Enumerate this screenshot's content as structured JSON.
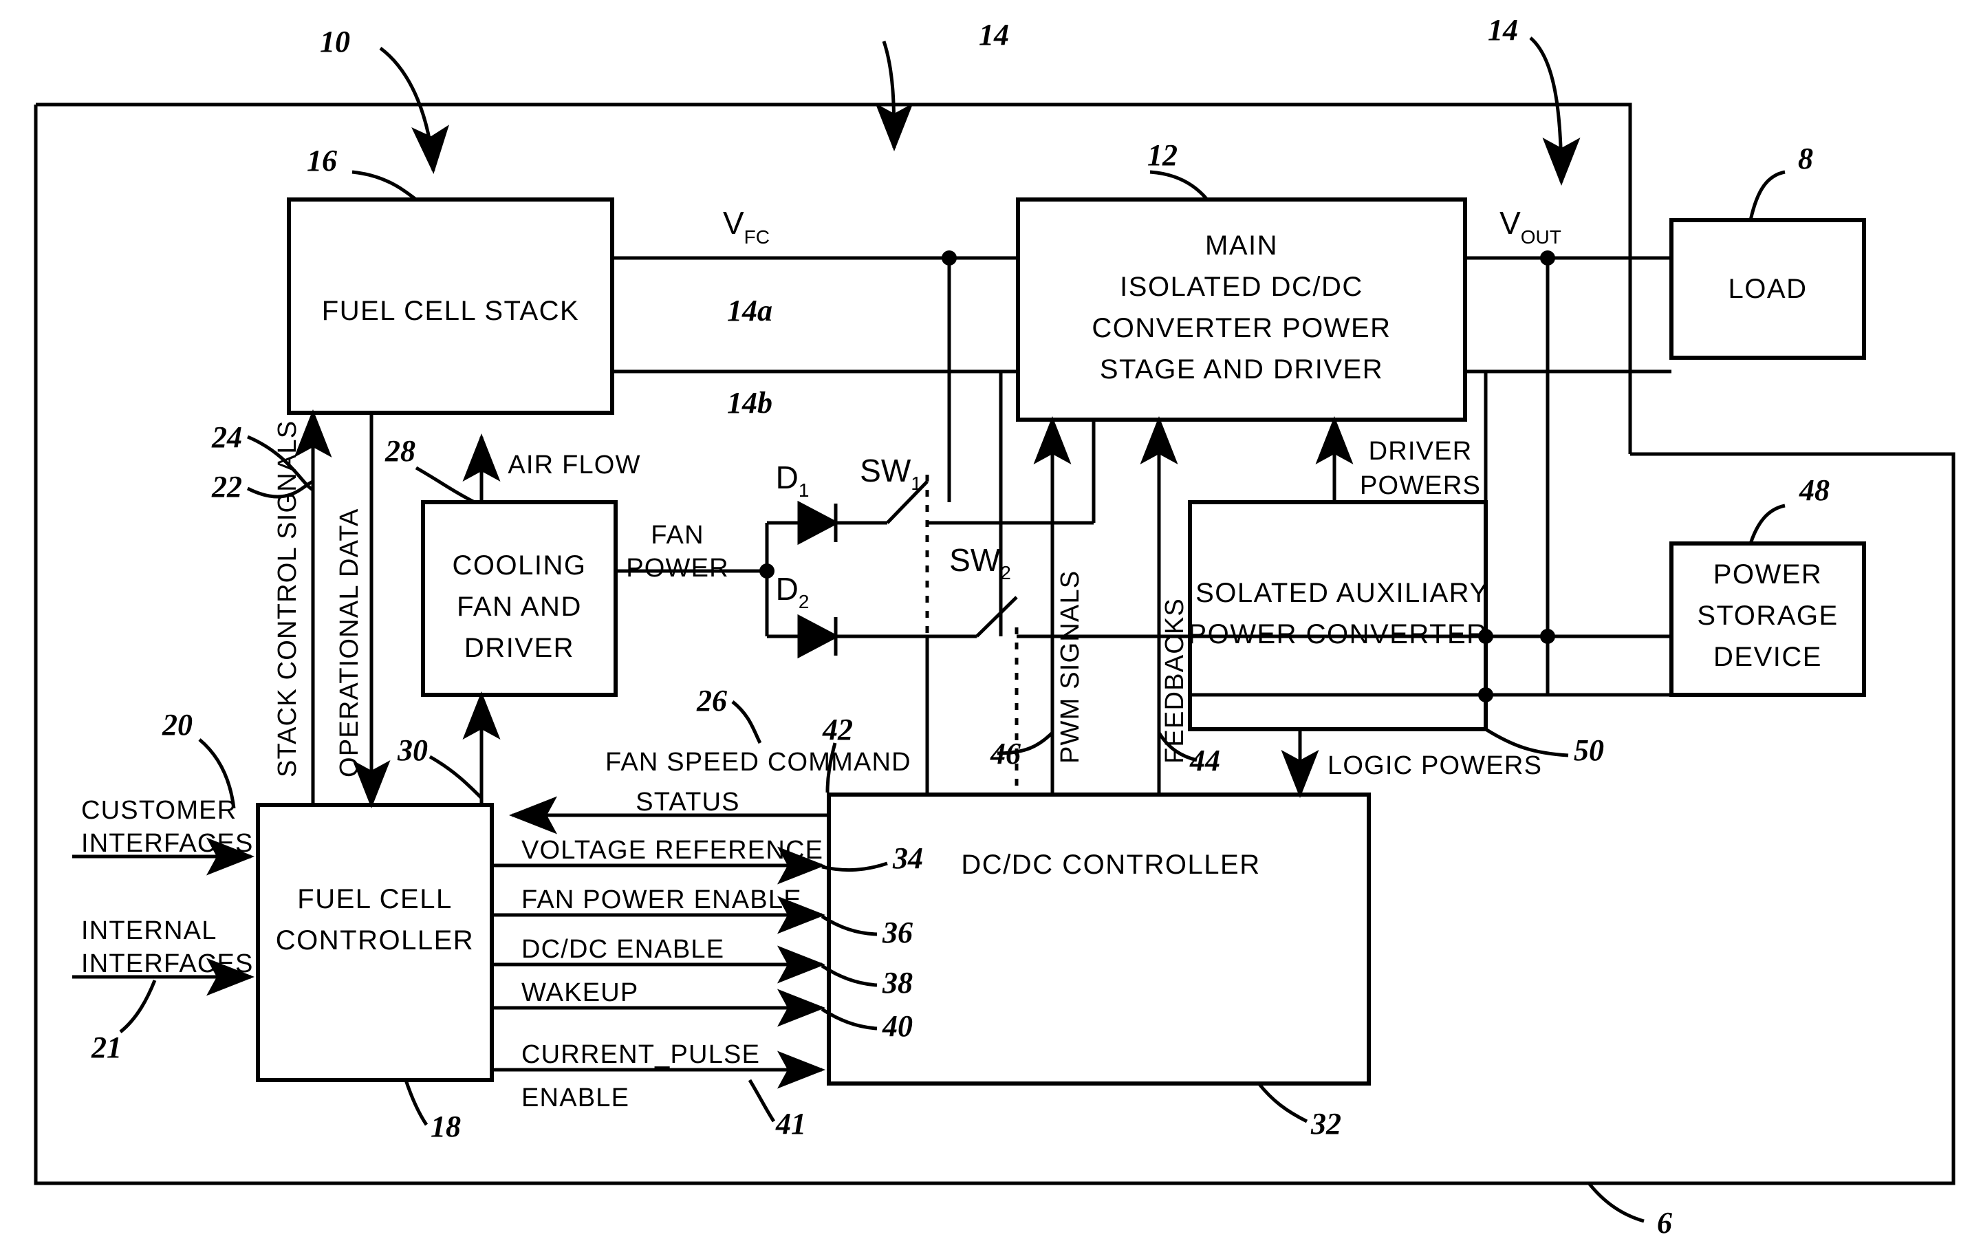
{
  "figure": {
    "outer_ref": "6",
    "system_ref": "10",
    "bus_ref_top_left": "14",
    "bus_ref_top_right": "14"
  },
  "blocks": {
    "fuel_cell_stack": {
      "ref": "16",
      "lines": [
        "FUEL CELL STACK"
      ]
    },
    "main_converter": {
      "ref": "12",
      "lines": [
        "MAIN",
        "ISOLATED DC/DC",
        "CONVERTER POWER",
        "STAGE AND DRIVER"
      ]
    },
    "load": {
      "ref": "8",
      "lines": [
        "LOAD"
      ]
    },
    "power_storage": {
      "ref": "48",
      "lines": [
        "POWER",
        "STORAGE",
        "DEVICE"
      ]
    },
    "aux_converter": {
      "ref": "50",
      "lines": [
        "ISOLATED AUXILIARY",
        "POWER CONVERTER"
      ]
    },
    "cooling_fan": {
      "ref": "26",
      "lines": [
        "COOLING",
        "FAN AND",
        "DRIVER"
      ]
    },
    "fuel_cell_controller": {
      "ref": "18",
      "lines": [
        "FUEL CELL",
        "CONTROLLER"
      ]
    },
    "dcdc_controller": {
      "ref": "32",
      "lines": [
        "DC/DC CONTROLLER"
      ]
    }
  },
  "nets": {
    "vfc": {
      "label": "V",
      "sub": "FC"
    },
    "vout": {
      "label": "V",
      "sub": "OUT"
    },
    "bus_a": "14a",
    "bus_b": "14b"
  },
  "components": {
    "d1": {
      "label": "D",
      "sub": "1"
    },
    "d2": {
      "label": "D",
      "sub": "2"
    },
    "sw1": {
      "label": "SW",
      "sub": "1"
    },
    "sw2": {
      "label": "SW",
      "sub": "2"
    }
  },
  "signals": {
    "stack_control_signals": {
      "text": "STACK CONTROL SIGNALS",
      "ref": "22"
    },
    "operational_data": {
      "text": "OPERATIONAL DATA",
      "ref": "24"
    },
    "air_flow": {
      "text": "AIR FLOW",
      "ref": "28"
    },
    "fan_power": {
      "text": "FAN POWER"
    },
    "fan_speed_command": {
      "text": "FAN SPEED COMMAND",
      "ref": "30"
    },
    "pwm_signals": {
      "text": "PWM SIGNALS",
      "ref": "46"
    },
    "feedbacks": {
      "text": "FEEDBACKS",
      "ref": "44"
    },
    "driver_powers": {
      "text": "DRIVER POWERS"
    },
    "logic_powers": {
      "text": "LOGIC POWERS"
    },
    "customer_interfaces": {
      "text": "CUSTOMER INTERFACES",
      "ref": "20"
    },
    "internal_interfaces": {
      "text": "INTERNAL INTERFACES",
      "ref": "21"
    }
  },
  "controller_bus": [
    {
      "text": "STATUS",
      "ref": "42",
      "direction": "left"
    },
    {
      "text": "VOLTAGE REFERENCE",
      "ref": "34",
      "direction": "right"
    },
    {
      "text": "FAN POWER ENABLE",
      "ref": "36",
      "direction": "right"
    },
    {
      "text": "DC/DC ENABLE",
      "ref": "38",
      "direction": "right"
    },
    {
      "text": "WAKEUP",
      "ref": "40",
      "direction": "right"
    },
    {
      "text": "CURRENT_PULSE",
      "ref": "41",
      "direction": "right"
    },
    {
      "text": "ENABLE",
      "ref": "",
      "direction": "right"
    }
  ],
  "colors": {
    "ink": "#000000",
    "paper": "#ffffff"
  }
}
